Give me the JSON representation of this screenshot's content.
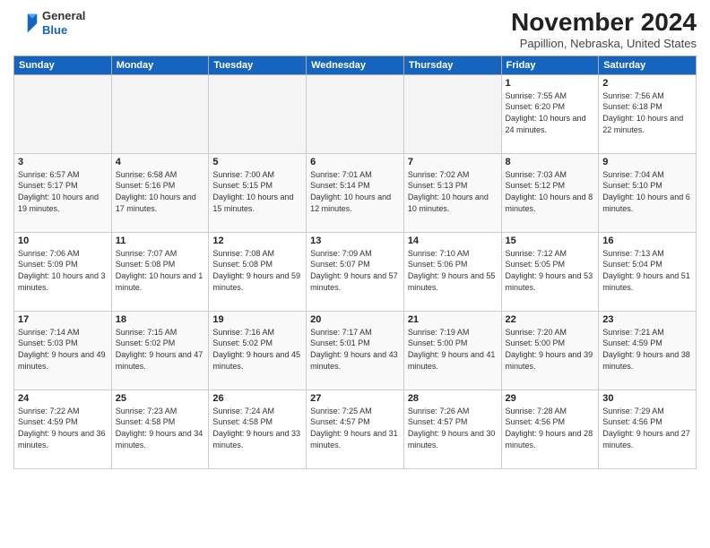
{
  "header": {
    "logo_line1": "General",
    "logo_line2": "Blue",
    "month_title": "November 2024",
    "location": "Papillion, Nebraska, United States"
  },
  "weekdays": [
    "Sunday",
    "Monday",
    "Tuesday",
    "Wednesday",
    "Thursday",
    "Friday",
    "Saturday"
  ],
  "weeks": [
    [
      {
        "day": "",
        "info": ""
      },
      {
        "day": "",
        "info": ""
      },
      {
        "day": "",
        "info": ""
      },
      {
        "day": "",
        "info": ""
      },
      {
        "day": "",
        "info": ""
      },
      {
        "day": "1",
        "info": "Sunrise: 7:55 AM\nSunset: 6:20 PM\nDaylight: 10 hours\nand 24 minutes."
      },
      {
        "day": "2",
        "info": "Sunrise: 7:56 AM\nSunset: 6:18 PM\nDaylight: 10 hours\nand 22 minutes."
      }
    ],
    [
      {
        "day": "3",
        "info": "Sunrise: 6:57 AM\nSunset: 5:17 PM\nDaylight: 10 hours\nand 19 minutes."
      },
      {
        "day": "4",
        "info": "Sunrise: 6:58 AM\nSunset: 5:16 PM\nDaylight: 10 hours\nand 17 minutes."
      },
      {
        "day": "5",
        "info": "Sunrise: 7:00 AM\nSunset: 5:15 PM\nDaylight: 10 hours\nand 15 minutes."
      },
      {
        "day": "6",
        "info": "Sunrise: 7:01 AM\nSunset: 5:14 PM\nDaylight: 10 hours\nand 12 minutes."
      },
      {
        "day": "7",
        "info": "Sunrise: 7:02 AM\nSunset: 5:13 PM\nDaylight: 10 hours\nand 10 minutes."
      },
      {
        "day": "8",
        "info": "Sunrise: 7:03 AM\nSunset: 5:12 PM\nDaylight: 10 hours\nand 8 minutes."
      },
      {
        "day": "9",
        "info": "Sunrise: 7:04 AM\nSunset: 5:10 PM\nDaylight: 10 hours\nand 6 minutes."
      }
    ],
    [
      {
        "day": "10",
        "info": "Sunrise: 7:06 AM\nSunset: 5:09 PM\nDaylight: 10 hours\nand 3 minutes."
      },
      {
        "day": "11",
        "info": "Sunrise: 7:07 AM\nSunset: 5:08 PM\nDaylight: 10 hours\nand 1 minute."
      },
      {
        "day": "12",
        "info": "Sunrise: 7:08 AM\nSunset: 5:08 PM\nDaylight: 9 hours\nand 59 minutes."
      },
      {
        "day": "13",
        "info": "Sunrise: 7:09 AM\nSunset: 5:07 PM\nDaylight: 9 hours\nand 57 minutes."
      },
      {
        "day": "14",
        "info": "Sunrise: 7:10 AM\nSunset: 5:06 PM\nDaylight: 9 hours\nand 55 minutes."
      },
      {
        "day": "15",
        "info": "Sunrise: 7:12 AM\nSunset: 5:05 PM\nDaylight: 9 hours\nand 53 minutes."
      },
      {
        "day": "16",
        "info": "Sunrise: 7:13 AM\nSunset: 5:04 PM\nDaylight: 9 hours\nand 51 minutes."
      }
    ],
    [
      {
        "day": "17",
        "info": "Sunrise: 7:14 AM\nSunset: 5:03 PM\nDaylight: 9 hours\nand 49 minutes."
      },
      {
        "day": "18",
        "info": "Sunrise: 7:15 AM\nSunset: 5:02 PM\nDaylight: 9 hours\nand 47 minutes."
      },
      {
        "day": "19",
        "info": "Sunrise: 7:16 AM\nSunset: 5:02 PM\nDaylight: 9 hours\nand 45 minutes."
      },
      {
        "day": "20",
        "info": "Sunrise: 7:17 AM\nSunset: 5:01 PM\nDaylight: 9 hours\nand 43 minutes."
      },
      {
        "day": "21",
        "info": "Sunrise: 7:19 AM\nSunset: 5:00 PM\nDaylight: 9 hours\nand 41 minutes."
      },
      {
        "day": "22",
        "info": "Sunrise: 7:20 AM\nSunset: 5:00 PM\nDaylight: 9 hours\nand 39 minutes."
      },
      {
        "day": "23",
        "info": "Sunrise: 7:21 AM\nSunset: 4:59 PM\nDaylight: 9 hours\nand 38 minutes."
      }
    ],
    [
      {
        "day": "24",
        "info": "Sunrise: 7:22 AM\nSunset: 4:59 PM\nDaylight: 9 hours\nand 36 minutes."
      },
      {
        "day": "25",
        "info": "Sunrise: 7:23 AM\nSunset: 4:58 PM\nDaylight: 9 hours\nand 34 minutes."
      },
      {
        "day": "26",
        "info": "Sunrise: 7:24 AM\nSunset: 4:58 PM\nDaylight: 9 hours\nand 33 minutes."
      },
      {
        "day": "27",
        "info": "Sunrise: 7:25 AM\nSunset: 4:57 PM\nDaylight: 9 hours\nand 31 minutes."
      },
      {
        "day": "28",
        "info": "Sunrise: 7:26 AM\nSunset: 4:57 PM\nDaylight: 9 hours\nand 30 minutes."
      },
      {
        "day": "29",
        "info": "Sunrise: 7:28 AM\nSunset: 4:56 PM\nDaylight: 9 hours\nand 28 minutes."
      },
      {
        "day": "30",
        "info": "Sunrise: 7:29 AM\nSunset: 4:56 PM\nDaylight: 9 hours\nand 27 minutes."
      }
    ]
  ]
}
